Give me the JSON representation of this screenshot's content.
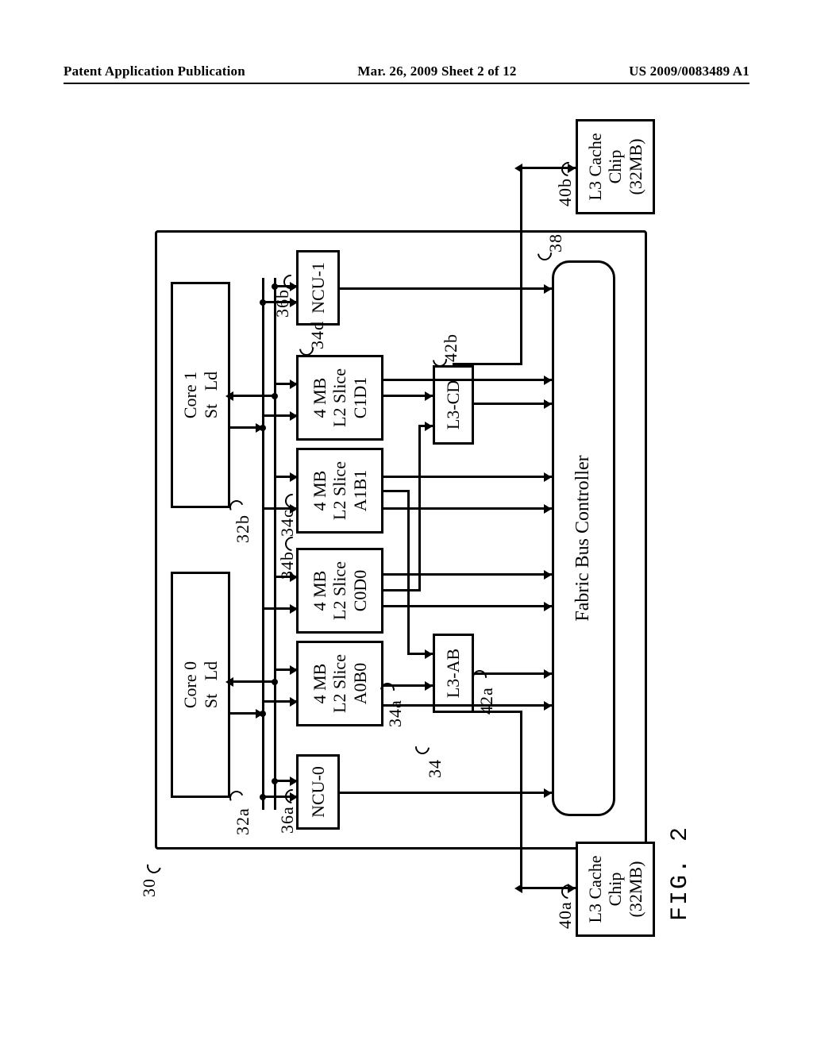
{
  "header": {
    "left": "Patent Application Publication",
    "center": "Mar. 26, 2009  Sheet 2 of 12",
    "right": "US 2009/0083489 A1"
  },
  "figure": {
    "caption": "FIG.  2",
    "ref_chip": "30",
    "cores": [
      {
        "title": "Core 0",
        "st": "St",
        "ld": "Ld",
        "ref": "32a"
      },
      {
        "title": "Core 1",
        "st": "St",
        "ld": "Ld",
        "ref": "32b"
      }
    ],
    "ncu": [
      {
        "label": "NCU-0",
        "ref": "36a"
      },
      {
        "label": "NCU-1",
        "ref": "36b"
      }
    ],
    "l2_group_ref": "34",
    "l2_slices": [
      {
        "line1": "4 MB",
        "line2": "L2 Slice",
        "line3": "A0B0",
        "ref": "34a"
      },
      {
        "line1": "4 MB",
        "line2": "L2 Slice",
        "line3": "C0D0",
        "ref": "34b"
      },
      {
        "line1": "4 MB",
        "line2": "L2 Slice",
        "line3": "A1B1",
        "ref": "34c"
      },
      {
        "line1": "4 MB",
        "line2": "L2 Slice",
        "line3": "C1D1",
        "ref": "34d"
      }
    ],
    "l3ctrl": [
      {
        "label": "L3-AB",
        "ref": "42a"
      },
      {
        "label": "L3-CD",
        "ref": "42b"
      }
    ],
    "fabric": {
      "label": "Fabric Bus Controller",
      "ref": "38"
    },
    "l3cache": [
      {
        "line1": "L3 Cache",
        "line2": "Chip",
        "line3": "(32MB)",
        "ref": "40a"
      },
      {
        "line1": "L3 Cache",
        "line2": "Chip",
        "line3": "(32MB)",
        "ref": "40b"
      }
    ]
  }
}
